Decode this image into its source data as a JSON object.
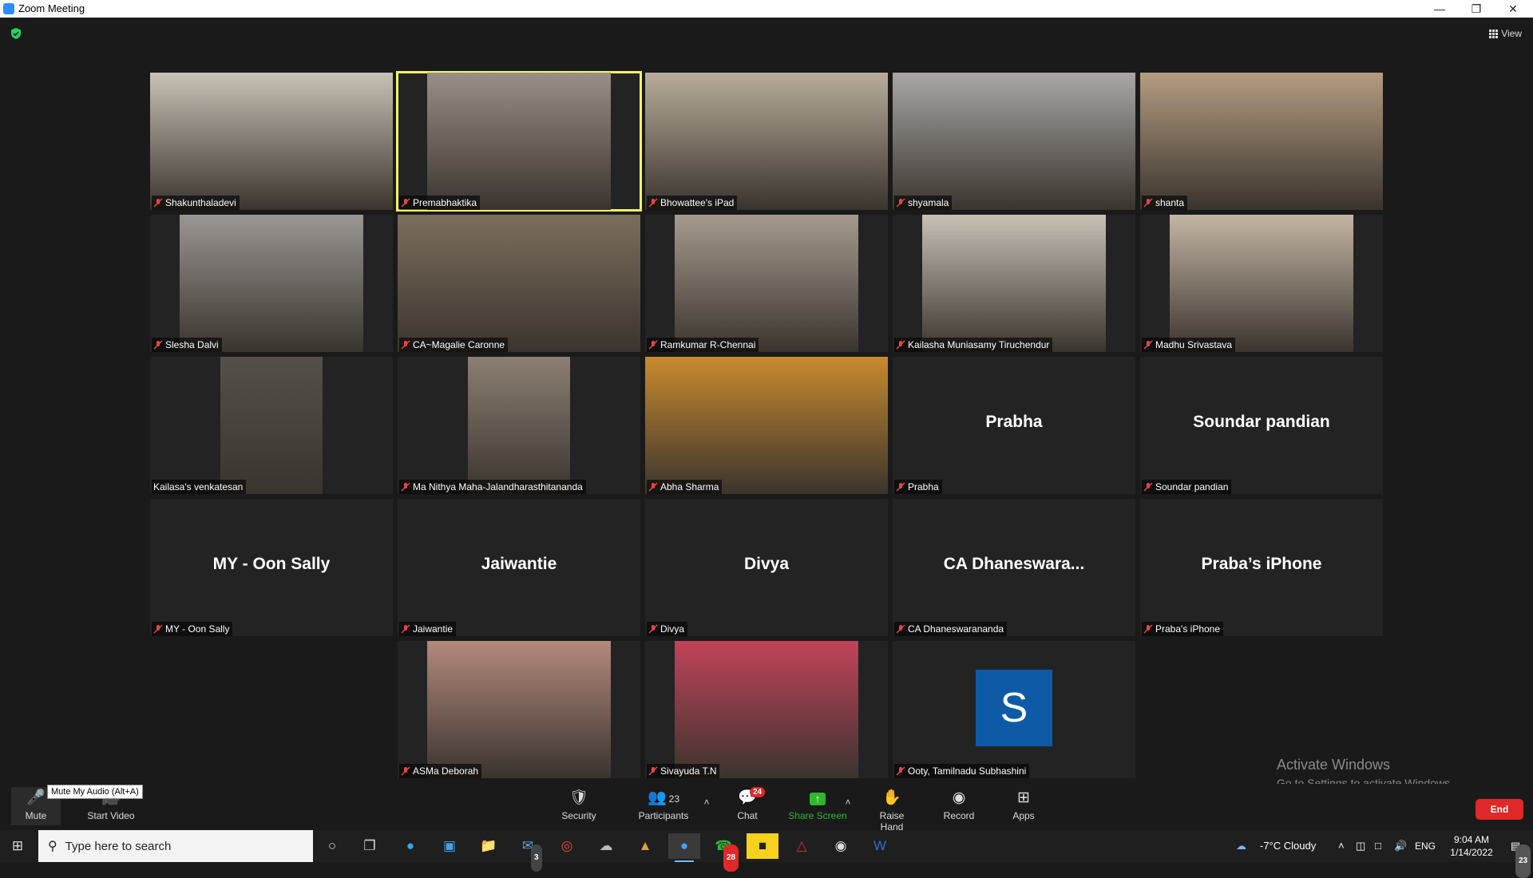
{
  "window": {
    "title": "Zoom Meeting",
    "minimize_icon": "minimize-icon",
    "restore_icon": "restore-icon",
    "close_icon": "close-icon"
  },
  "topbar": {
    "view_label": "View"
  },
  "participants": [
    {
      "name": "Shakunthaladevi",
      "bg": "#c9c2b6"
    },
    {
      "name": "Premabhaktika",
      "bg": "#9a8f86",
      "active": true
    },
    {
      "name": "Bhowattee's iPad",
      "bg": "#b8ad9a"
    },
    {
      "name": "shyamala",
      "bg": "#a9a6a4"
    },
    {
      "name": "shanta",
      "bg": "#b49c80"
    },
    {
      "name": "Slesha Dalvi",
      "bg": "#9b9692"
    },
    {
      "name": "CA~Magalie Caronne",
      "bg": "#7c6e5d"
    },
    {
      "name": "Ramkumar R-Chennai",
      "bg": "#a69a8e"
    },
    {
      "name": "Kailasha Muniasamy Tiruchendur",
      "bg": "#c7c1b6"
    },
    {
      "name": "Madhu Srivastava",
      "bg": "#c4b6a4"
    },
    {
      "name": "Kailasa's venkatesan",
      "bg": "#55504a"
    },
    {
      "name": "Ma Nithya Maha-Jalandharasthitananda",
      "bg": "#8c7f73"
    },
    {
      "name": "Abha Sharma",
      "bg": "#c98a2e"
    },
    {
      "name": "Prabha",
      "display": "Prabha"
    },
    {
      "name": "Soundar pandian",
      "display": "Soundar pandian"
    },
    {
      "name": "MY - Oon Sally",
      "display": "MY - Oon Sally"
    },
    {
      "name": "Jaiwantie",
      "display": "Jaiwantie"
    },
    {
      "name": "Divya",
      "display": "Divya"
    },
    {
      "name": "CA Dhaneswarananda",
      "display": "CA  Dhaneswara..."
    },
    {
      "name": "Praba's iPhone",
      "display": "Praba’s iPhone"
    },
    {
      "name": "ASMa Deborah",
      "bg": "#b3897c"
    },
    {
      "name": "Sivayuda T.N",
      "bg": "#c2435a"
    },
    {
      "name": "Ooty, Tamilnadu Subhashini",
      "avatar_letter": "S"
    }
  ],
  "toolbar": {
    "mute": "Mute",
    "mute_tooltip": "Mute My Audio (Alt+A)",
    "start_video": "Start Video",
    "security": "Security",
    "participants": "Participants",
    "participants_count": "23",
    "chat": "Chat",
    "chat_badge": "24",
    "share_screen": "Share Screen",
    "raise_hand": "Raise Hand",
    "record": "Record",
    "apps": "Apps",
    "end": "End",
    "accent_green": "#2eb82e",
    "end_red": "#e02828"
  },
  "watermark": {
    "line1": "Activate Windows",
    "line2": "Go to Settings to activate Windows."
  },
  "taskbar": {
    "search_placeholder": "Type here to search",
    "mail_badge": "3",
    "whatsapp_badge": "28",
    "weather": "-7°C  Cloudy",
    "language": "ENG",
    "time": "9:04 AM",
    "date": "1/14/2022",
    "notification_count": "23"
  }
}
